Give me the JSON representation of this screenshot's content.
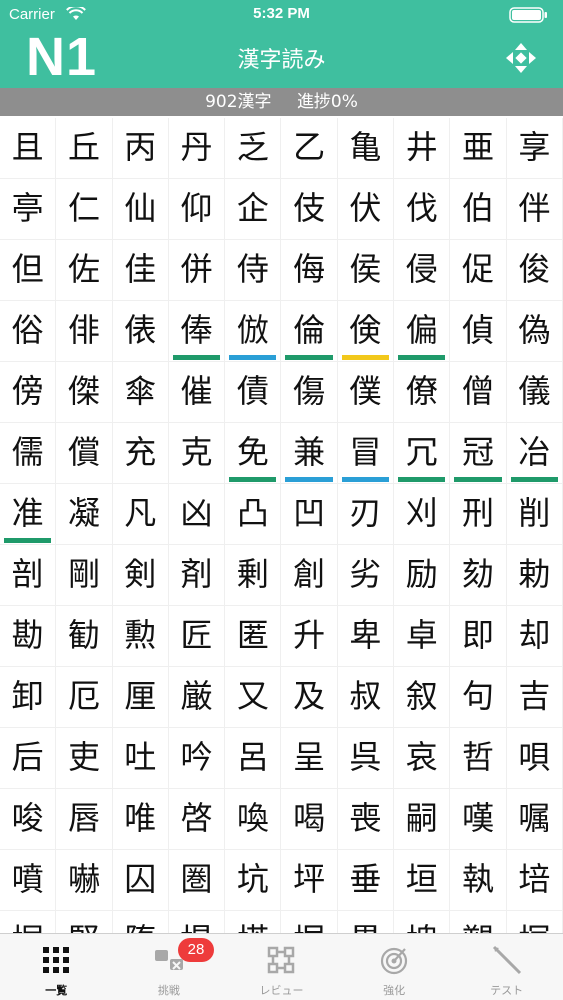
{
  "status_bar": {
    "carrier": "Carrier",
    "time": "5:32 PM"
  },
  "header": {
    "level": "N1",
    "title": "漢字読み",
    "menu_icon": "move-arrows-icon"
  },
  "summary": {
    "count": "902漢字",
    "progress": "進捗0%"
  },
  "colors": {
    "teal": "#3fbf9f",
    "green": "#1f9a6a",
    "blue": "#2a9fd6",
    "yellow": "#f2c81b",
    "badge": "#ee3b3b"
  },
  "kanji_rows": [
    [
      {
        "k": "且"
      },
      {
        "k": "丘"
      },
      {
        "k": "丙"
      },
      {
        "k": "丹"
      },
      {
        "k": "乏"
      },
      {
        "k": "乙"
      },
      {
        "k": "亀"
      },
      {
        "k": "井"
      },
      {
        "k": "亜"
      },
      {
        "k": "享"
      }
    ],
    [
      {
        "k": "亭"
      },
      {
        "k": "仁"
      },
      {
        "k": "仙"
      },
      {
        "k": "仰"
      },
      {
        "k": "企"
      },
      {
        "k": "伎"
      },
      {
        "k": "伏"
      },
      {
        "k": "伐"
      },
      {
        "k": "伯"
      },
      {
        "k": "伴"
      }
    ],
    [
      {
        "k": "但"
      },
      {
        "k": "佐"
      },
      {
        "k": "佳"
      },
      {
        "k": "併"
      },
      {
        "k": "侍"
      },
      {
        "k": "侮"
      },
      {
        "k": "侯"
      },
      {
        "k": "侵"
      },
      {
        "k": "促"
      },
      {
        "k": "俊"
      }
    ],
    [
      {
        "k": "俗"
      },
      {
        "k": "俳"
      },
      {
        "k": "俵"
      },
      {
        "k": "俸",
        "m": "green"
      },
      {
        "k": "倣",
        "m": "blue"
      },
      {
        "k": "倫",
        "m": "green"
      },
      {
        "k": "倹",
        "m": "yellow"
      },
      {
        "k": "偏",
        "m": "green"
      },
      {
        "k": "偵"
      },
      {
        "k": "偽"
      }
    ],
    [
      {
        "k": "傍"
      },
      {
        "k": "傑"
      },
      {
        "k": "傘"
      },
      {
        "k": "催"
      },
      {
        "k": "債"
      },
      {
        "k": "傷"
      },
      {
        "k": "僕"
      },
      {
        "k": "僚"
      },
      {
        "k": "僧"
      },
      {
        "k": "儀"
      }
    ],
    [
      {
        "k": "儒"
      },
      {
        "k": "償"
      },
      {
        "k": "充"
      },
      {
        "k": "克"
      },
      {
        "k": "免",
        "m": "green"
      },
      {
        "k": "兼",
        "m": "blue"
      },
      {
        "k": "冒",
        "m": "blue"
      },
      {
        "k": "冗",
        "m": "green"
      },
      {
        "k": "冠",
        "m": "green"
      },
      {
        "k": "冶",
        "m": "green"
      }
    ],
    [
      {
        "k": "准",
        "m": "green"
      },
      {
        "k": "凝"
      },
      {
        "k": "凡"
      },
      {
        "k": "凶"
      },
      {
        "k": "凸"
      },
      {
        "k": "凹"
      },
      {
        "k": "刃"
      },
      {
        "k": "刈"
      },
      {
        "k": "刑"
      },
      {
        "k": "削"
      }
    ],
    [
      {
        "k": "剖"
      },
      {
        "k": "剛"
      },
      {
        "k": "剣"
      },
      {
        "k": "剤"
      },
      {
        "k": "剰"
      },
      {
        "k": "創"
      },
      {
        "k": "劣"
      },
      {
        "k": "励"
      },
      {
        "k": "劾"
      },
      {
        "k": "勅"
      }
    ],
    [
      {
        "k": "勘"
      },
      {
        "k": "勧"
      },
      {
        "k": "勲"
      },
      {
        "k": "匠"
      },
      {
        "k": "匿"
      },
      {
        "k": "升"
      },
      {
        "k": "卑"
      },
      {
        "k": "卓"
      },
      {
        "k": "即"
      },
      {
        "k": "却"
      }
    ],
    [
      {
        "k": "卸"
      },
      {
        "k": "厄"
      },
      {
        "k": "厘"
      },
      {
        "k": "厳"
      },
      {
        "k": "又"
      },
      {
        "k": "及"
      },
      {
        "k": "叔"
      },
      {
        "k": "叙"
      },
      {
        "k": "句"
      },
      {
        "k": "吉"
      }
    ],
    [
      {
        "k": "后"
      },
      {
        "k": "吏"
      },
      {
        "k": "吐"
      },
      {
        "k": "吟"
      },
      {
        "k": "呂"
      },
      {
        "k": "呈"
      },
      {
        "k": "呉"
      },
      {
        "k": "哀"
      },
      {
        "k": "哲"
      },
      {
        "k": "唄"
      }
    ],
    [
      {
        "k": "唆"
      },
      {
        "k": "唇"
      },
      {
        "k": "唯"
      },
      {
        "k": "啓"
      },
      {
        "k": "喚"
      },
      {
        "k": "喝"
      },
      {
        "k": "喪"
      },
      {
        "k": "嗣"
      },
      {
        "k": "嘆"
      },
      {
        "k": "嘱"
      }
    ],
    [
      {
        "k": "噴"
      },
      {
        "k": "嚇"
      },
      {
        "k": "囚"
      },
      {
        "k": "圏"
      },
      {
        "k": "坑"
      },
      {
        "k": "坪"
      },
      {
        "k": "垂"
      },
      {
        "k": "垣"
      },
      {
        "k": "執"
      },
      {
        "k": "培"
      }
    ],
    [
      {
        "k": "堀"
      },
      {
        "k": "堅"
      },
      {
        "k": "堕"
      },
      {
        "k": "堤"
      },
      {
        "k": "塔"
      },
      {
        "k": "塀"
      },
      {
        "k": "塁"
      },
      {
        "k": "塊"
      },
      {
        "k": "塑"
      },
      {
        "k": "塚"
      }
    ]
  ],
  "tabs": [
    {
      "label": "一覧",
      "icon": "grid-icon",
      "active": true
    },
    {
      "label": "挑戦",
      "icon": "challenge-icon",
      "active": false
    },
    {
      "label": "レビュー",
      "icon": "review-icon",
      "active": false
    },
    {
      "label": "強化",
      "icon": "target-icon",
      "active": false
    },
    {
      "label": "テスト",
      "icon": "pencil-icon",
      "active": false
    }
  ],
  "challenge_badge": "28"
}
